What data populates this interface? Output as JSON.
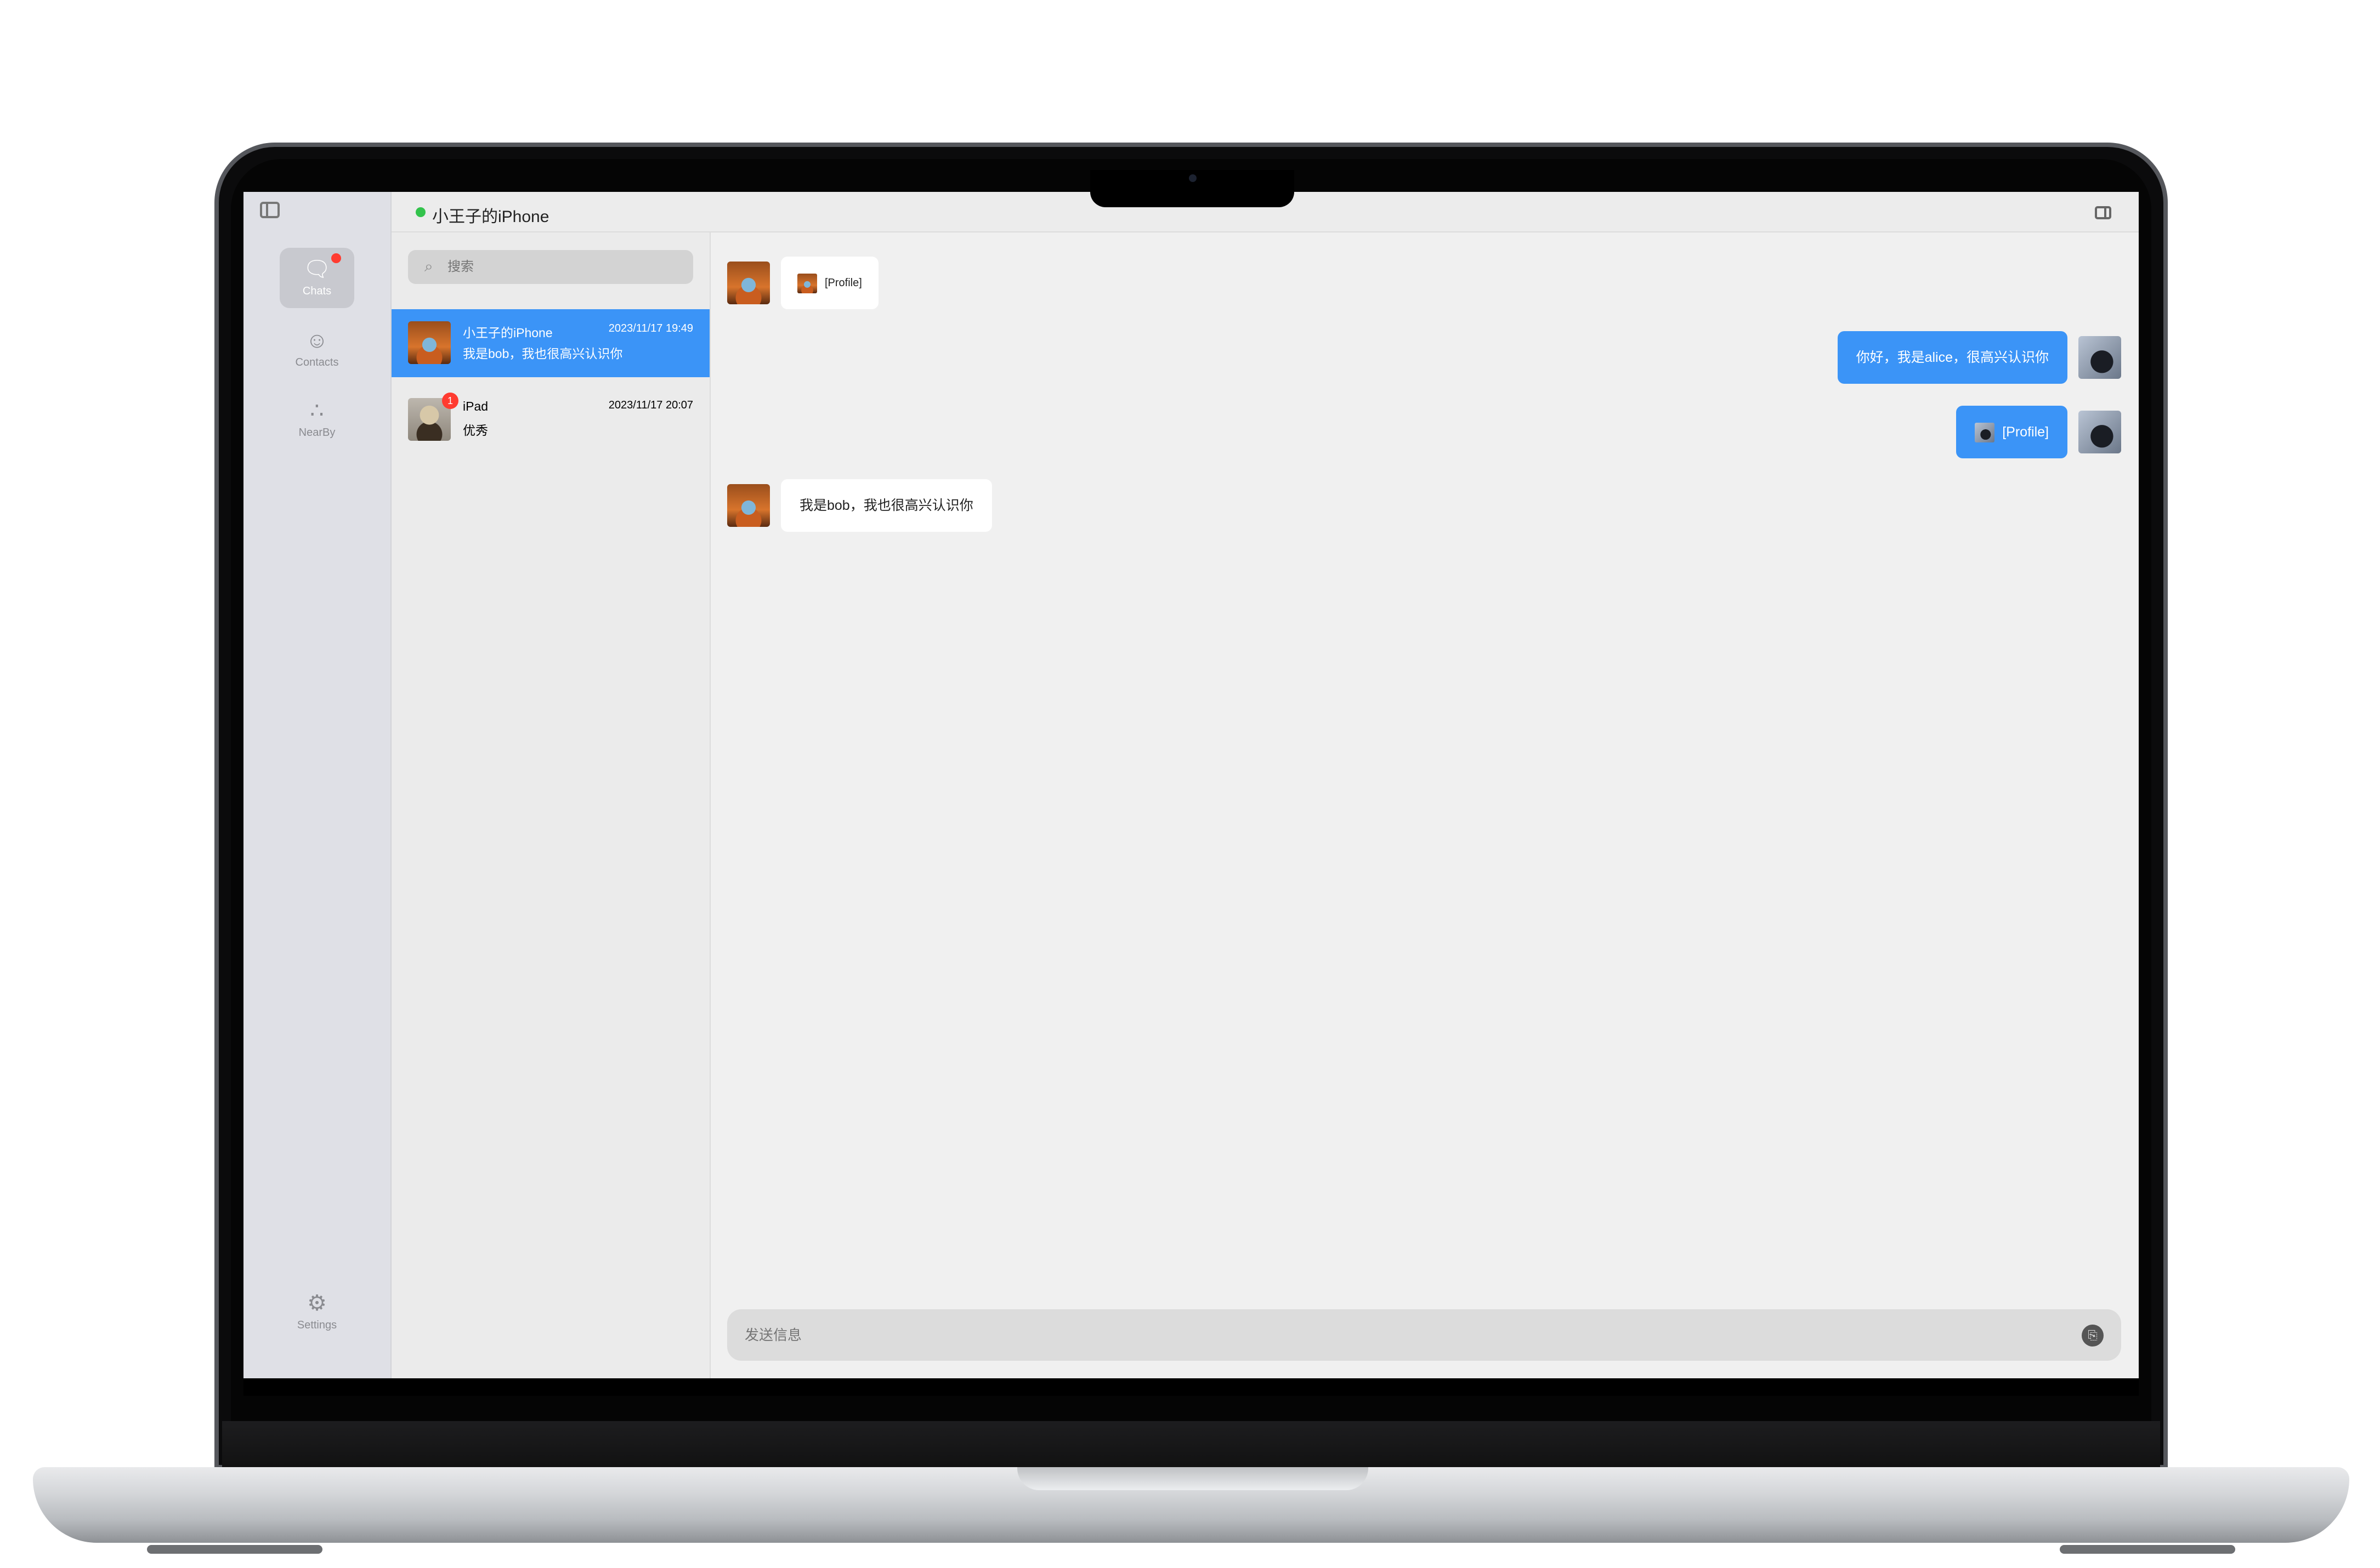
{
  "app": {
    "title": "小王子的iPhone"
  },
  "rail": {
    "items": [
      {
        "label": "Chats",
        "icon": "chat-bubble-icon"
      },
      {
        "label": "Contacts",
        "icon": "contacts-icon"
      },
      {
        "label": "NearBy",
        "icon": "nearby-icon"
      }
    ],
    "settings_label": "Settings"
  },
  "search": {
    "placeholder": "搜索"
  },
  "chats": [
    {
      "name": "小王子的iPhone",
      "time": "2023/11/17 19:49",
      "preview": "我是bob，我也很高兴认识你",
      "selected": true
    },
    {
      "name": "iPad",
      "time": "2023/11/17 20:07",
      "preview": "优秀",
      "unread": "1"
    }
  ],
  "messages": [
    {
      "direction": "in",
      "text": "[Profile]"
    },
    {
      "direction": "out",
      "text": "你好，我是alice，很高兴认识你"
    },
    {
      "direction": "out",
      "text": "[Profile]"
    },
    {
      "direction": "in",
      "text": "我是bob，我也很高兴认识你"
    }
  ],
  "composer": {
    "placeholder": "发送信息"
  },
  "colors": {
    "accent": "#3b94f7",
    "online": "#33c34c",
    "badge": "#ff3b30"
  }
}
